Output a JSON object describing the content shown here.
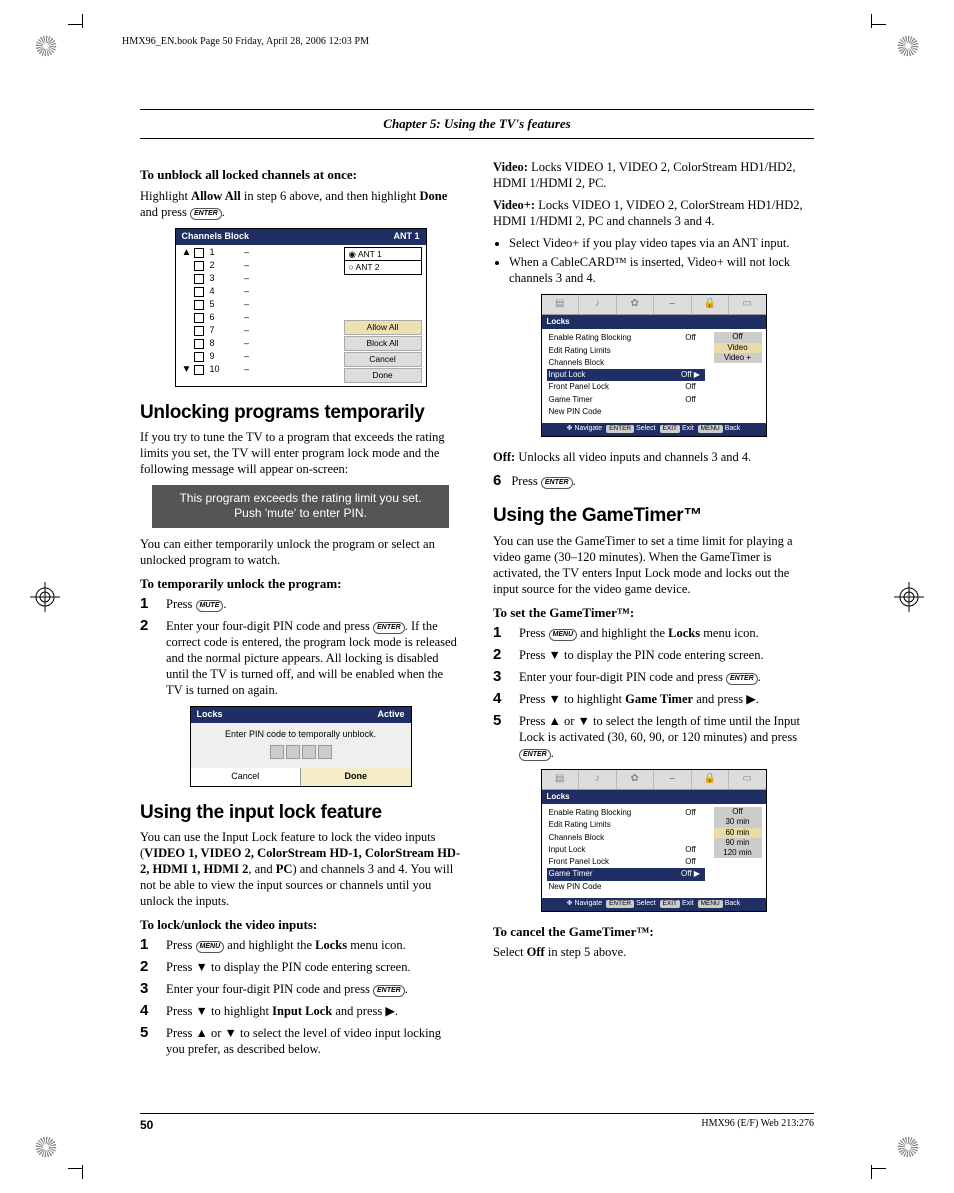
{
  "header": {
    "fileline": "HMX96_EN.book  Page 50  Friday, April 28, 2006  12:03 PM",
    "chapter": "Chapter 5: Using the TV's features"
  },
  "left": {
    "unblock_heading": "To unblock all locked channels at once:",
    "unblock_text_pre": "Highlight ",
    "unblock_allow": "Allow All",
    "unblock_text_mid": " in step 6 above, and then highlight ",
    "unblock_done": "Done",
    "unblock_text_post": " and press ",
    "chan_block": {
      "title": "Channels Block",
      "ant": "ANT 1",
      "rows": [
        "1",
        "2",
        "3",
        "4",
        "5",
        "6",
        "7",
        "8",
        "9",
        "10"
      ],
      "right_labels": {
        "ant1": "ANT 1",
        "ant2": "ANT 2",
        "allow": "Allow All",
        "block": "Block All",
        "cancel": "Cancel",
        "done": "Done"
      }
    },
    "unlock_title": "Unlocking programs temporarily",
    "unlock_para": "If you try to tune the TV to a program that exceeds the rating limits you set, the TV will enter program lock mode and the following message will appear on-screen:",
    "msg_l1": "This program exceeds the rating limit you set.",
    "msg_l2": "Push 'mute' to enter PIN.",
    "unlock_after": "You can either temporarily unlock the program or select an unlocked program to watch.",
    "tmp_heading": "To temporarily unlock the program:",
    "step1": "Press ",
    "step2_a": "Enter your four-digit PIN code and press ",
    "step2_b": ". If the correct code is entered, the program lock mode is released and the normal picture appears. All locking is disabled until the TV is turned off, and will be enabled when the TV is turned on again.",
    "pin": {
      "title": "Locks",
      "status": "Active",
      "body": "Enter PIN code to temporally unblock.",
      "cancel": "Cancel",
      "done": "Done"
    },
    "inputlock_title": "Using the input lock feature",
    "inputlock_para_a": "You can use the Input Lock feature to lock the video inputs (",
    "inputlock_bold": "VIDEO 1, VIDEO 2, ColorStream HD-1, ColorStream HD-2, HDMI 1, HDMI 2",
    "inputlock_para_b": ", and ",
    "inputlock_pc": "PC",
    "inputlock_para_c": ") and channels 3 and 4. You will not be able to view the input sources or channels until you unlock the inputs.",
    "lock_heading": "To lock/unlock the video inputs:",
    "ls1_a": "Press ",
    "ls1_b": " and highlight the ",
    "ls1_bold": "Locks",
    "ls1_c": " menu icon.",
    "ls2": "Press ▼ to display the PIN code entering screen.",
    "ls3_a": "Enter your four-digit PIN code and press ",
    "ls4_a": "Press ▼ to highlight ",
    "ls4_bold": "Input Lock",
    "ls4_b": " and press ▶.",
    "ls5": "Press ▲ or ▼ to select the level of video input locking you prefer, as described below."
  },
  "right": {
    "video_label": "Video:",
    "video_text": " Locks VIDEO 1, VIDEO 2, ColorStream HD1/HD2, HDMI 1/HDMI 2, PC.",
    "videoplus_label": "Video+:",
    "videoplus_text": " Locks VIDEO 1, VIDEO 2, ColorStream HD1/HD2, HDMI 1/HDMI 2, PC and channels 3 and 4.",
    "b1": "Select Video+ if you play video tapes via an ANT input.",
    "b2": "When a CableCARD™ is inserted, Video+ will not lock channels 3 and 4.",
    "locks1": {
      "title": "Locks",
      "rows": [
        {
          "label": "Enable Rating Blocking",
          "val": "Off"
        },
        {
          "label": "Edit Rating Limits",
          "val": ""
        },
        {
          "label": "Channels Block",
          "val": ""
        },
        {
          "label": "Input Lock",
          "val": "Off",
          "hl": true,
          "arrow": "▶"
        },
        {
          "label": "Front Panel Lock",
          "val": "Off"
        },
        {
          "label": "Game Timer",
          "val": "Off"
        },
        {
          "label": "New PIN Code",
          "val": ""
        }
      ],
      "side": [
        "Off",
        "Video",
        "Video +"
      ],
      "side_sel": 1,
      "footer": {
        "nav": "Navigate",
        "sel": "Select",
        "exit": "Exit",
        "back": "Back"
      }
    },
    "off_label": "Off:",
    "off_text": " Unlocks all video inputs and channels 3 and 4.",
    "step6_n": "6",
    "step6": "Press ",
    "gt_title": "Using the GameTimer™",
    "gt_para": "You can use the GameTimer to set a time limit for playing a video game (30–120 minutes). When the GameTimer is activated, the TV enters Input Lock mode and locks out the input source for the video game device.",
    "gt_set_heading": "To set the GameTimer™:",
    "g1_a": "Press ",
    "g1_b": " and highlight the ",
    "g1_bold": "Locks",
    "g1_c": " menu icon.",
    "g2": "Press ▼ to display the PIN code entering screen.",
    "g3": "Enter your four-digit PIN code and press ",
    "g4_a": "Press ▼ to highlight ",
    "g4_bold": "Game Timer",
    "g4_b": " and press ▶.",
    "g5": "Press ▲ or ▼ to select the length of time until the Input Lock is activated (30, 60, 90, or 120 minutes) and press ",
    "locks2": {
      "title": "Locks",
      "rows": [
        {
          "label": "Enable Rating Blocking",
          "val": "Off"
        },
        {
          "label": "Edit Rating Limits",
          "val": ""
        },
        {
          "label": "Channels Block",
          "val": ""
        },
        {
          "label": "Input Lock",
          "val": "Off"
        },
        {
          "label": "Front Panel Lock",
          "val": "Off"
        },
        {
          "label": "Game Timer",
          "val": "Off",
          "hl": true,
          "arrow": "▶"
        },
        {
          "label": "New PIN Code",
          "val": ""
        }
      ],
      "side": [
        "Off",
        "30 min",
        "60 min",
        "90 min",
        "120 min"
      ],
      "side_sel": 2,
      "footer": {
        "nav": "Navigate",
        "sel": "Select",
        "exit": "Exit",
        "back": "Back"
      }
    },
    "gt_cancel_heading": "To cancel the GameTimer™:",
    "gt_cancel_text_a": "Select ",
    "gt_cancel_bold": "Off",
    "gt_cancel_text_b": " in step 5 above."
  },
  "keys": {
    "enter": "ENTER",
    "mute": "MUTE",
    "menu": "MENU"
  },
  "footer": {
    "page": "50",
    "right": "HMX96 (E/F) Web 213:276"
  }
}
